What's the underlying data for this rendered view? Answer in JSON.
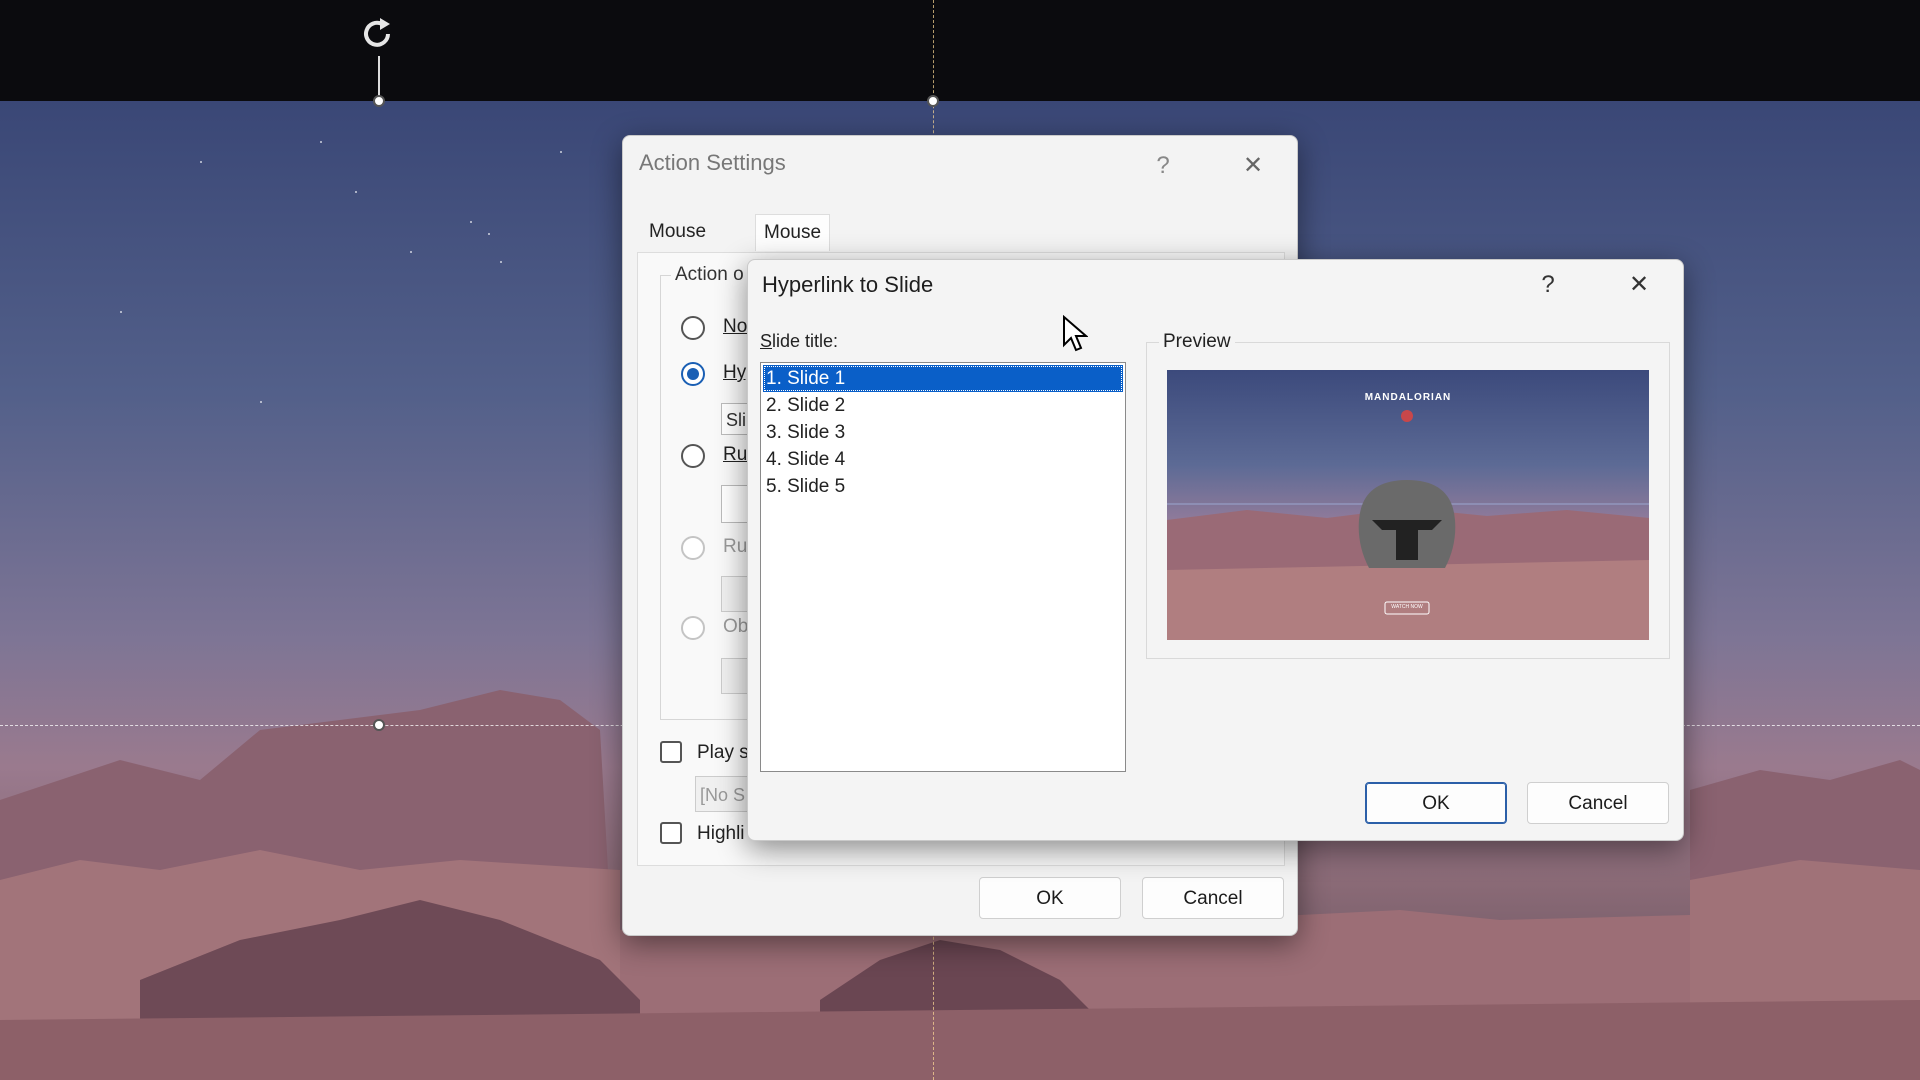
{
  "action_settings": {
    "title": "Action Settings",
    "help_glyph": "?",
    "close_glyph": "✕",
    "tabs": [
      "Mouse Click",
      "Mouse Over"
    ],
    "active_tab": "Mouse Over",
    "group_label": "Action o",
    "options": [
      {
        "label": "No",
        "state": "unchecked"
      },
      {
        "label": "Hyp",
        "state": "checked"
      },
      {
        "label": "Ru",
        "state": "unchecked"
      },
      {
        "label": "Ru",
        "state": "disabled"
      },
      {
        "label": "Ob",
        "state": "disabled"
      }
    ],
    "hyperlink_field": "Sli",
    "play_sound_label": "Play s",
    "sound_field": "[No S",
    "highlight_label": "Highli",
    "ok_label": "OK",
    "cancel_label": "Cancel"
  },
  "hyperlink_dialog": {
    "title": "Hyperlink to Slide",
    "help_glyph": "?",
    "close_glyph": "✕",
    "slide_title_label_first": "S",
    "slide_title_label_rest": "lide title:",
    "slides": [
      "1. Slide 1",
      "2. Slide 2",
      "3. Slide 3",
      "4. Slide 4",
      "5. Slide 5"
    ],
    "selected_slide": "1. Slide 1",
    "preview_label": "Preview",
    "preview_logo": "MANDALORIAN",
    "preview_button": "WATCH NOW",
    "ok_label": "OK",
    "cancel_label": "Cancel"
  },
  "slide_editor": {
    "rotate_glyph": "⟳"
  }
}
